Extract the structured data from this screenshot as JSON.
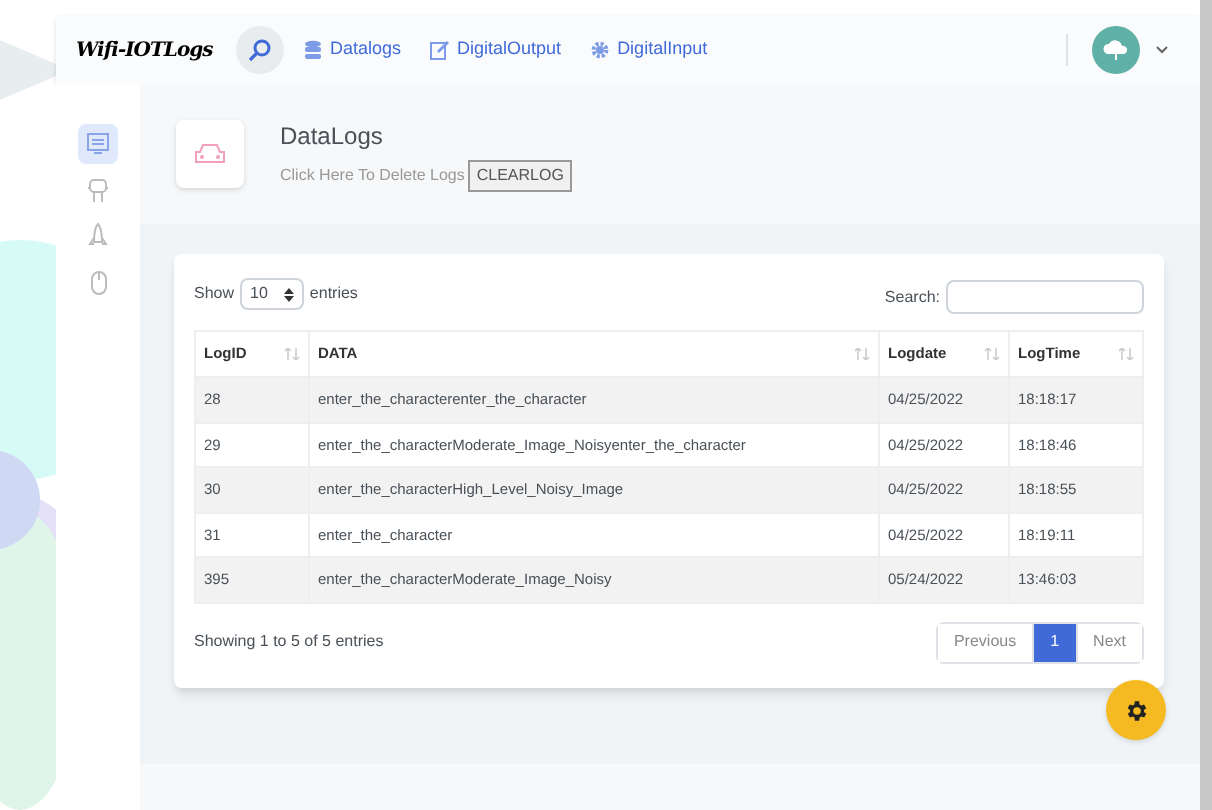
{
  "navbar": {
    "logo": "Wifi-IOTLogs",
    "links": [
      {
        "label": "Datalogs",
        "kind": "database"
      },
      {
        "label": "DigitalOutput",
        "kind": "edit"
      },
      {
        "label": "DigitalInput",
        "kind": "gear"
      }
    ]
  },
  "sidebar": {
    "items": [
      {
        "kind": "monitor",
        "selected": true
      },
      {
        "kind": "robot",
        "selected": false
      },
      {
        "kind": "rocket",
        "selected": false
      },
      {
        "kind": "mouse",
        "selected": false
      }
    ]
  },
  "page_header": {
    "title": "DataLogs",
    "subtitle": "Click Here To Delete Logs",
    "button": "CLEARLOG"
  },
  "table_controls": {
    "show_label": "Show",
    "page_size": "10",
    "entries_label": "entries",
    "search_label": "Search:"
  },
  "table": {
    "columns": [
      "LogID",
      "DATA",
      "Logdate",
      "LogTime"
    ],
    "rows": [
      [
        "28",
        "enter_the_characterenter_the_character",
        "04/25/2022",
        "18:18:17"
      ],
      [
        "29",
        "enter_the_characterModerate_Image_Noisyenter_the_character",
        "04/25/2022",
        "18:18:46"
      ],
      [
        "30",
        "enter_the_characterHigh_Level_Noisy_Image",
        "04/25/2022",
        "18:18:55"
      ],
      [
        "31",
        "enter_the_character",
        "04/25/2022",
        "18:19:11"
      ],
      [
        "395",
        "enter_the_characterModerate_Image_Noisy",
        "05/24/2022",
        "13:46:03"
      ]
    ]
  },
  "footer": {
    "info": "Showing 1 to 5 of 5 entries",
    "pagination": [
      {
        "label": "Previous",
        "selected": false
      },
      {
        "label": "1",
        "selected": true
      },
      {
        "label": "Next",
        "selected": false
      }
    ]
  }
}
